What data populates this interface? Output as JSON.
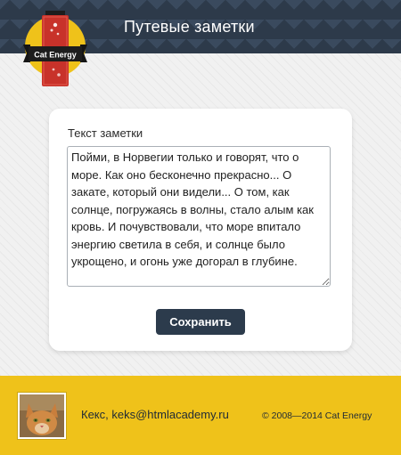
{
  "header": {
    "title": "Путевые заметки",
    "logo_text": "Cat Energy"
  },
  "note_form": {
    "label": "Текст заметки",
    "text": "Пойми, в Норвегии только и говорят, что о море. Как оно бесконечно прекрасно... О закате, который они видели... О том, как солнце, погружаясь в волны, стало алым как кровь. И почувствовали, что море впитало энергию светила в себя, и солнце было укрощено, и огонь уже догорал в глубине.",
    "save_label": "Сохранить"
  },
  "footer": {
    "contact": "Кекс, keks@htmlacademy.ru",
    "copyright": "© 2008—2014 Cat Energy"
  },
  "colors": {
    "header_bg": "#2d3a4a",
    "accent_yellow": "#efc21a",
    "logo_red": "#c8322a",
    "button_bg": "#2c3b4c"
  }
}
